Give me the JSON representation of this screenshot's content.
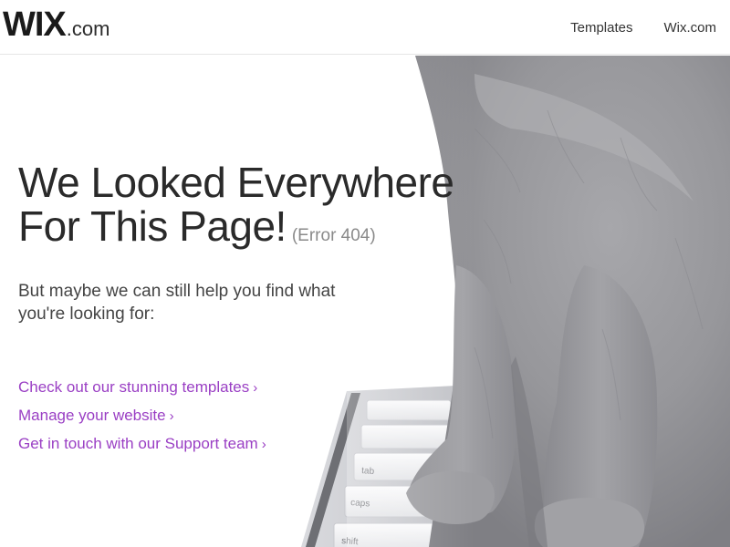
{
  "header": {
    "logo_main": "WIX",
    "logo_suffix": ".com",
    "nav": [
      {
        "label": "Templates"
      },
      {
        "label": "Wix.com"
      }
    ]
  },
  "main": {
    "heading_line1": "We Looked Everywhere",
    "heading_line2": "For This Page!",
    "error_code": "(Error 404)",
    "subtext": "But maybe we can still help you find what you're looking for:",
    "links": [
      {
        "label": "Check out our stunning templates",
        "chevron": "›"
      },
      {
        "label": "Manage your website",
        "chevron": "›"
      },
      {
        "label": "Get in touch with our Support team",
        "chevron": "›"
      }
    ]
  },
  "keyboard_keys": [
    "tab",
    "caps",
    "shift"
  ],
  "colors": {
    "link": "#9a3fc4",
    "logo_dot": "#fbbd08",
    "cat_fur": "#9a9a9e",
    "heading": "#2a2a2a"
  }
}
